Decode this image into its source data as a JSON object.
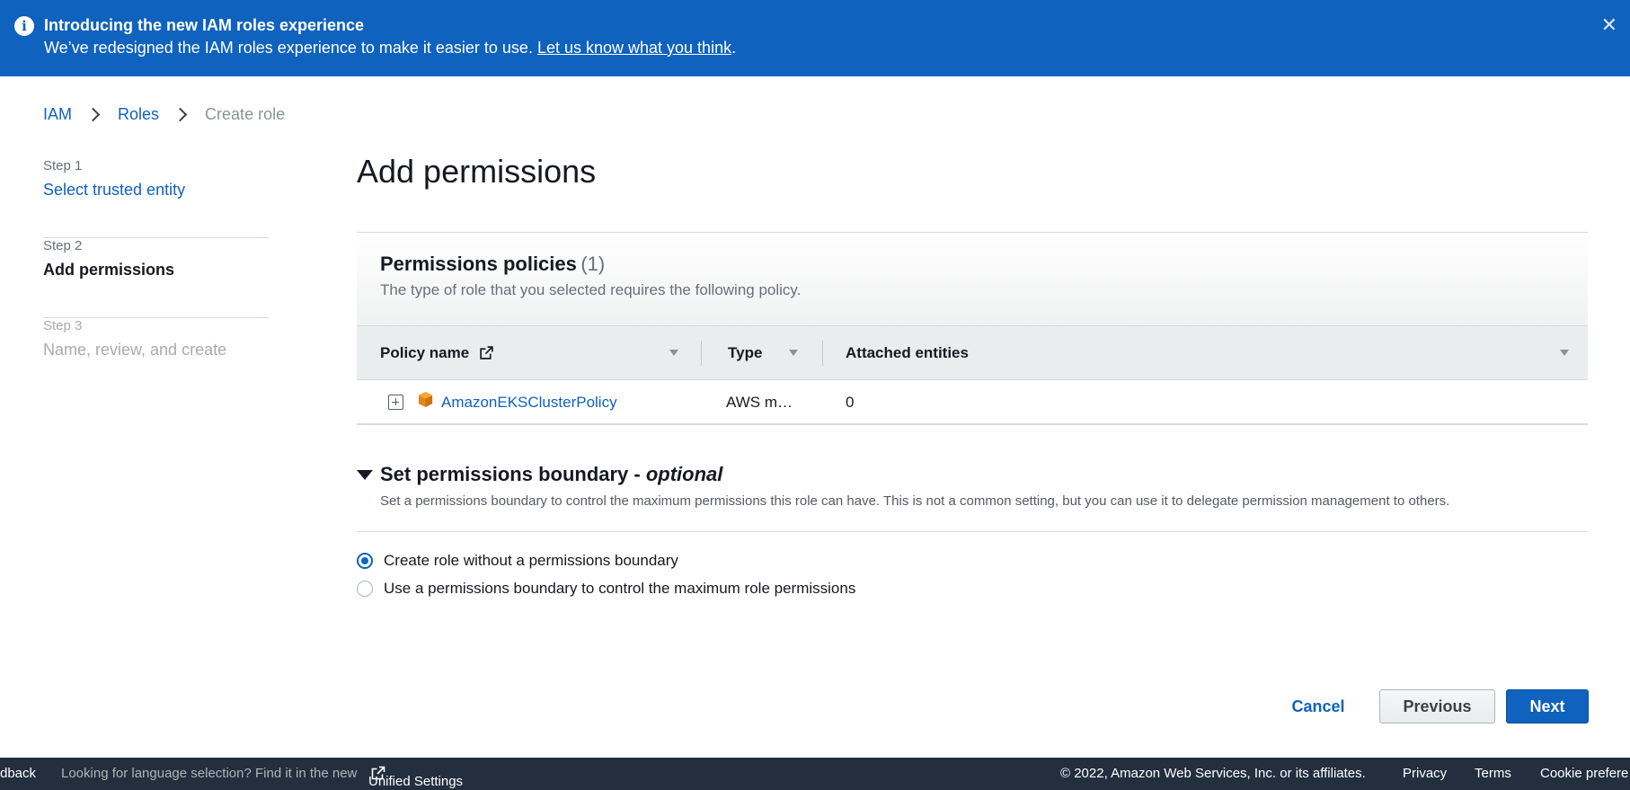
{
  "banner": {
    "icon": "info-icon",
    "title": "Introducing the new IAM roles experience",
    "text": "We’ve redesigned the IAM roles experience to make it easier to use. ",
    "link": "Let us know what you think",
    "link_suffix": ".",
    "close": "✕",
    "color": "#0f62bd"
  },
  "breadcrumb": {
    "items": [
      "IAM",
      "Roles",
      "Create role"
    ]
  },
  "steps": [
    {
      "number": "Step 1",
      "name": "Select trusted entity"
    },
    {
      "number": "Step 2",
      "name": "Add permissions"
    },
    {
      "number": "Step 3",
      "name": "Name, review, and create"
    }
  ],
  "page_title": "Add permissions",
  "policies": {
    "title": "Permissions policies",
    "count": "(1)",
    "description": "The type of role that you selected requires the following policy.",
    "columns": [
      "Policy name",
      "Type",
      "Attached entities"
    ],
    "rows": [
      {
        "name": "AmazonEKSClusterPolicy",
        "type": "AWS m…",
        "entities": "0"
      }
    ]
  },
  "boundary": {
    "title": "Set permissions boundary - ",
    "title_optional": "optional",
    "description": "Set a permissions boundary to control the maximum permissions this role can have. This is not a common setting, but you can use it to delegate permission management to others.",
    "options": [
      {
        "label": "Create role without a permissions boundary",
        "selected": true
      },
      {
        "label": "Use a permissions boundary to control the maximum role permissions",
        "selected": false
      }
    ]
  },
  "actions": {
    "cancel": "Cancel",
    "previous": "Previous",
    "next": "Next"
  },
  "footer": {
    "feedback": "dback",
    "language_text": "Looking for language selection? Find it in the new",
    "unified_settings": "Unified Settings",
    "copyright": "© 2022, Amazon Web Services, Inc. or its affiliates.",
    "privacy": "Privacy",
    "terms": "Terms",
    "cookie": "Cookie prefere"
  }
}
